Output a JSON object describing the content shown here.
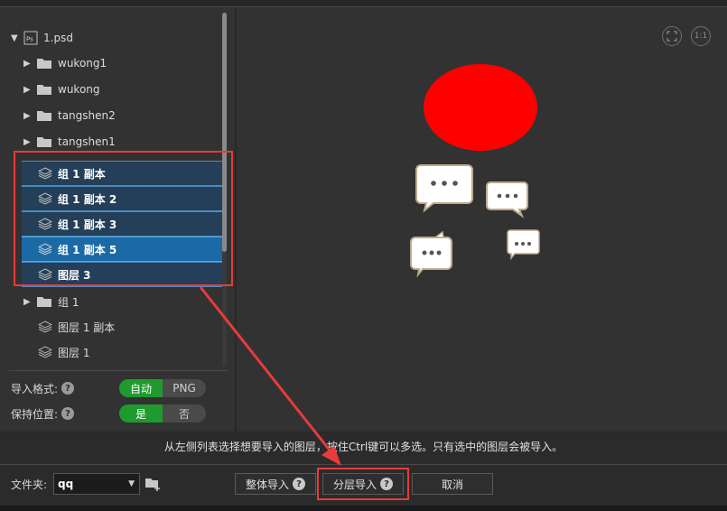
{
  "tree": {
    "root": {
      "label": "1.psd",
      "icon": "psd-file-icon",
      "icon_text": "Ps"
    },
    "items": [
      {
        "label": "wukong1",
        "type": "folder",
        "selected": false
      },
      {
        "label": "wukong",
        "type": "folder",
        "selected": false
      },
      {
        "label": "tangshen2",
        "type": "folder",
        "selected": false
      },
      {
        "label": "tangshen1",
        "type": "folder",
        "selected": false
      },
      {
        "label": "组 1 副本",
        "type": "layer",
        "selected": true
      },
      {
        "label": "组 1 副本 2",
        "type": "layer",
        "selected": true
      },
      {
        "label": "组 1 副本 3",
        "type": "layer",
        "selected": true
      },
      {
        "label": "组 1 副本 5",
        "type": "layer",
        "selected": true,
        "active": true
      },
      {
        "label": "图层 3",
        "type": "layer",
        "selected": true
      },
      {
        "label": "组 1",
        "type": "folder",
        "selected": false
      },
      {
        "label": "图层 1 副本",
        "type": "layer",
        "selected": false
      },
      {
        "label": "图层 1",
        "type": "layer",
        "selected": false
      }
    ]
  },
  "options": {
    "format": {
      "label": "导入格式:",
      "help": "?",
      "on": "自动",
      "off": "PNG"
    },
    "position": {
      "label": "保持位置:",
      "help": "?",
      "on": "是",
      "off": "否"
    }
  },
  "preview": {
    "fit_icon": "fit-screen-icon",
    "actual_size_label": "1:1"
  },
  "hint": "从左侧列表选择想要导入的图层，按住Ctrl键可以多选。只有选中的图层会被导入。",
  "footer": {
    "folder_label": "文件夹:",
    "folder_value": "qq",
    "buttons": {
      "whole_import": "整体导入",
      "layered_import": "分层导入",
      "cancel": "取消",
      "help": "?"
    }
  },
  "colors": {
    "accent_red": "#e83b3b",
    "selection_blue": "#1b6aa6",
    "toggle_green": "#1e9a2e",
    "shape_red": "#ff0000"
  }
}
